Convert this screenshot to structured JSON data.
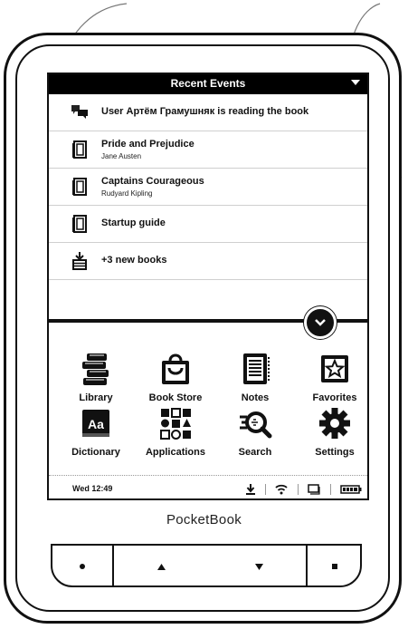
{
  "header": {
    "title": "Recent Events"
  },
  "events": [
    {
      "title": "User Артём Грамушняк is reading the book",
      "subtitle": "",
      "icon": "chat-icon"
    },
    {
      "title": "Pride and Prejudice",
      "subtitle": "Jane Austen",
      "icon": "book-icon"
    },
    {
      "title": "Captains Courageous",
      "subtitle": "Rudyard Kipling",
      "icon": "book-icon"
    },
    {
      "title": "Startup guide",
      "subtitle": "",
      "icon": "book-icon"
    },
    {
      "title": "+3 new books",
      "subtitle": "",
      "icon": "download-icon"
    }
  ],
  "apps": [
    {
      "label": "Library",
      "icon": "library-icon"
    },
    {
      "label": "Book Store",
      "icon": "store-icon"
    },
    {
      "label": "Notes",
      "icon": "notes-icon"
    },
    {
      "label": "Favorites",
      "icon": "favorites-icon"
    },
    {
      "label": "Dictionary",
      "icon": "dictionary-icon"
    },
    {
      "label": "Applications",
      "icon": "applications-icon"
    },
    {
      "label": "Search",
      "icon": "search-icon"
    },
    {
      "label": "Settings",
      "icon": "settings-icon"
    }
  ],
  "status": {
    "time": "Wed 12:49",
    "icons": [
      "download-icon",
      "wifi-icon",
      "window-icon",
      "battery-icon"
    ]
  },
  "brand": "PocketBook",
  "dictionary_glyph": "Aa"
}
